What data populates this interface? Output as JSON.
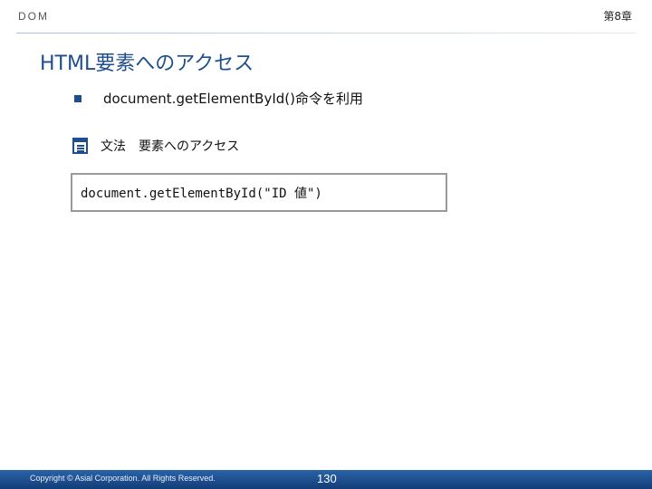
{
  "header": {
    "section": "DOM",
    "chapter": "第8章"
  },
  "title": "HTML要素へのアクセス",
  "bullet": {
    "text": "document.getElementById()命令を利用"
  },
  "syntax": {
    "icon": "document-list-icon",
    "label": "文法　要素へのアクセス"
  },
  "code": "document.getElementById(\"ID 値\")",
  "footer": {
    "copyright": "Copyright © Asial Corporation. All Rights Reserved.",
    "page": "130"
  },
  "colors": {
    "accent": "#1f4e8f",
    "footer_bg": "#1f4f8f"
  }
}
